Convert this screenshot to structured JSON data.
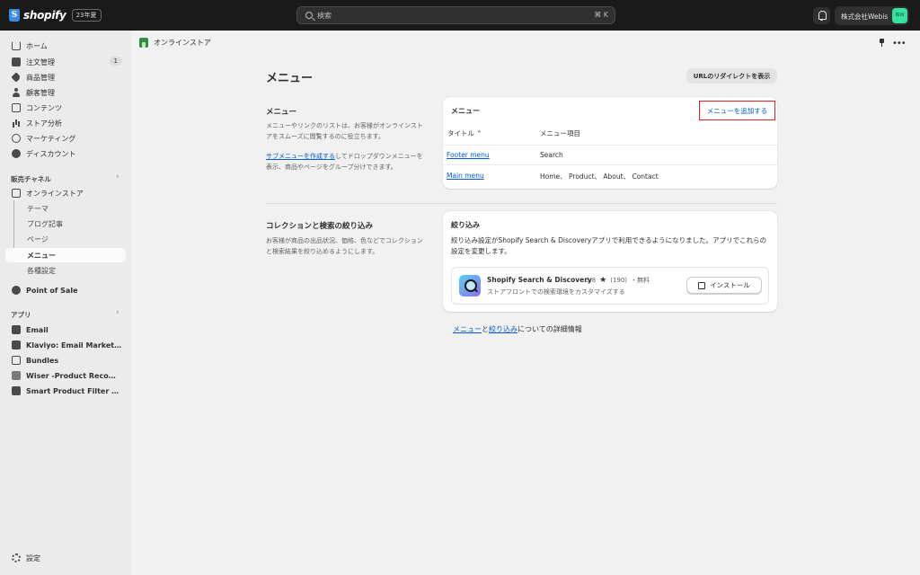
{
  "topbar": {
    "logo_text": "shopify",
    "logo_mark": "S",
    "badge": "23年夏",
    "search_placeholder": "検索",
    "search_shortcut": "⌘ K",
    "store_name": "株式会社Webis",
    "store_avatar": "株W"
  },
  "sidebar": {
    "items": [
      {
        "label": "ホーム",
        "icon": "home-icon"
      },
      {
        "label": "注文管理",
        "icon": "orders-icon",
        "badge": "1"
      },
      {
        "label": "商品管理",
        "icon": "products-icon"
      },
      {
        "label": "顧客管理",
        "icon": "customers-icon"
      },
      {
        "label": "コンテンツ",
        "icon": "content-icon"
      },
      {
        "label": "ストア分析",
        "icon": "analytics-icon"
      },
      {
        "label": "マーケティング",
        "icon": "marketing-icon"
      },
      {
        "label": "ディスカウント",
        "icon": "discount-icon"
      }
    ],
    "sales_channels_title": "販売チャネル",
    "online_store": "オンラインストア",
    "online_store_subs": [
      "テーマ",
      "ブログ記事",
      "ページ",
      "メニュー",
      "各種設定"
    ],
    "point_of_sale": "Point of Sale",
    "apps_title": "アプリ",
    "apps": [
      "Email",
      "Klaviyo: Email Marketing & SMS",
      "Bundles",
      "Wiser -Product Recommendations",
      "Smart Product Filter & Search"
    ],
    "settings": "設定"
  },
  "header": {
    "breadcrumb": "オンラインストア",
    "page_title": "メニュー",
    "redirect_button": "URLのリダイレクトを表示"
  },
  "menus_section": {
    "title": "メニュー",
    "desc": "メニューやリンクのリストは、お客様がオンラインストアをスムーズに閲覧するのに役立ちます。",
    "sub_link": "サブメニューを作成する",
    "sub_desc": "してドロップダウンメニューを表示、商品やページをグループ分けできます。",
    "card_title": "メニュー",
    "add_button": "メニューを追加する",
    "col_title": "タイトル",
    "col_items": "メニュー項目",
    "rows": [
      {
        "title": "Footer menu",
        "items": "Search"
      },
      {
        "title": "Main menu",
        "items": "Home、 Product、 About、 Contact"
      }
    ]
  },
  "filters_section": {
    "title": "コレクションと検索の絞り込み",
    "desc": "お客様が商品の出品状況、価格、色などでコレクションと検索結果を絞り込めるようにします。",
    "card_title": "絞り込み",
    "card_desc": "絞り込み設定がShopify Search & Discoveryアプリで利用できるようになりました。アプリでこれらの設定を変更します。",
    "app_name": "Shopify Search & Discovery",
    "app_rating": "3.8",
    "app_reviews": "(190)",
    "app_price": "・無料",
    "app_sub": "ストアフロントでの検索環境をカスタマイズする",
    "install_button": "インストール"
  },
  "footer_info": {
    "link1": "メニュー",
    "mid": "と",
    "link2": "絞り込み",
    "tail": "についての詳細情報"
  },
  "colors": {
    "accent": "#005bd3",
    "highlight_border": "#e51c23",
    "topbar": "#1a1a1a"
  }
}
